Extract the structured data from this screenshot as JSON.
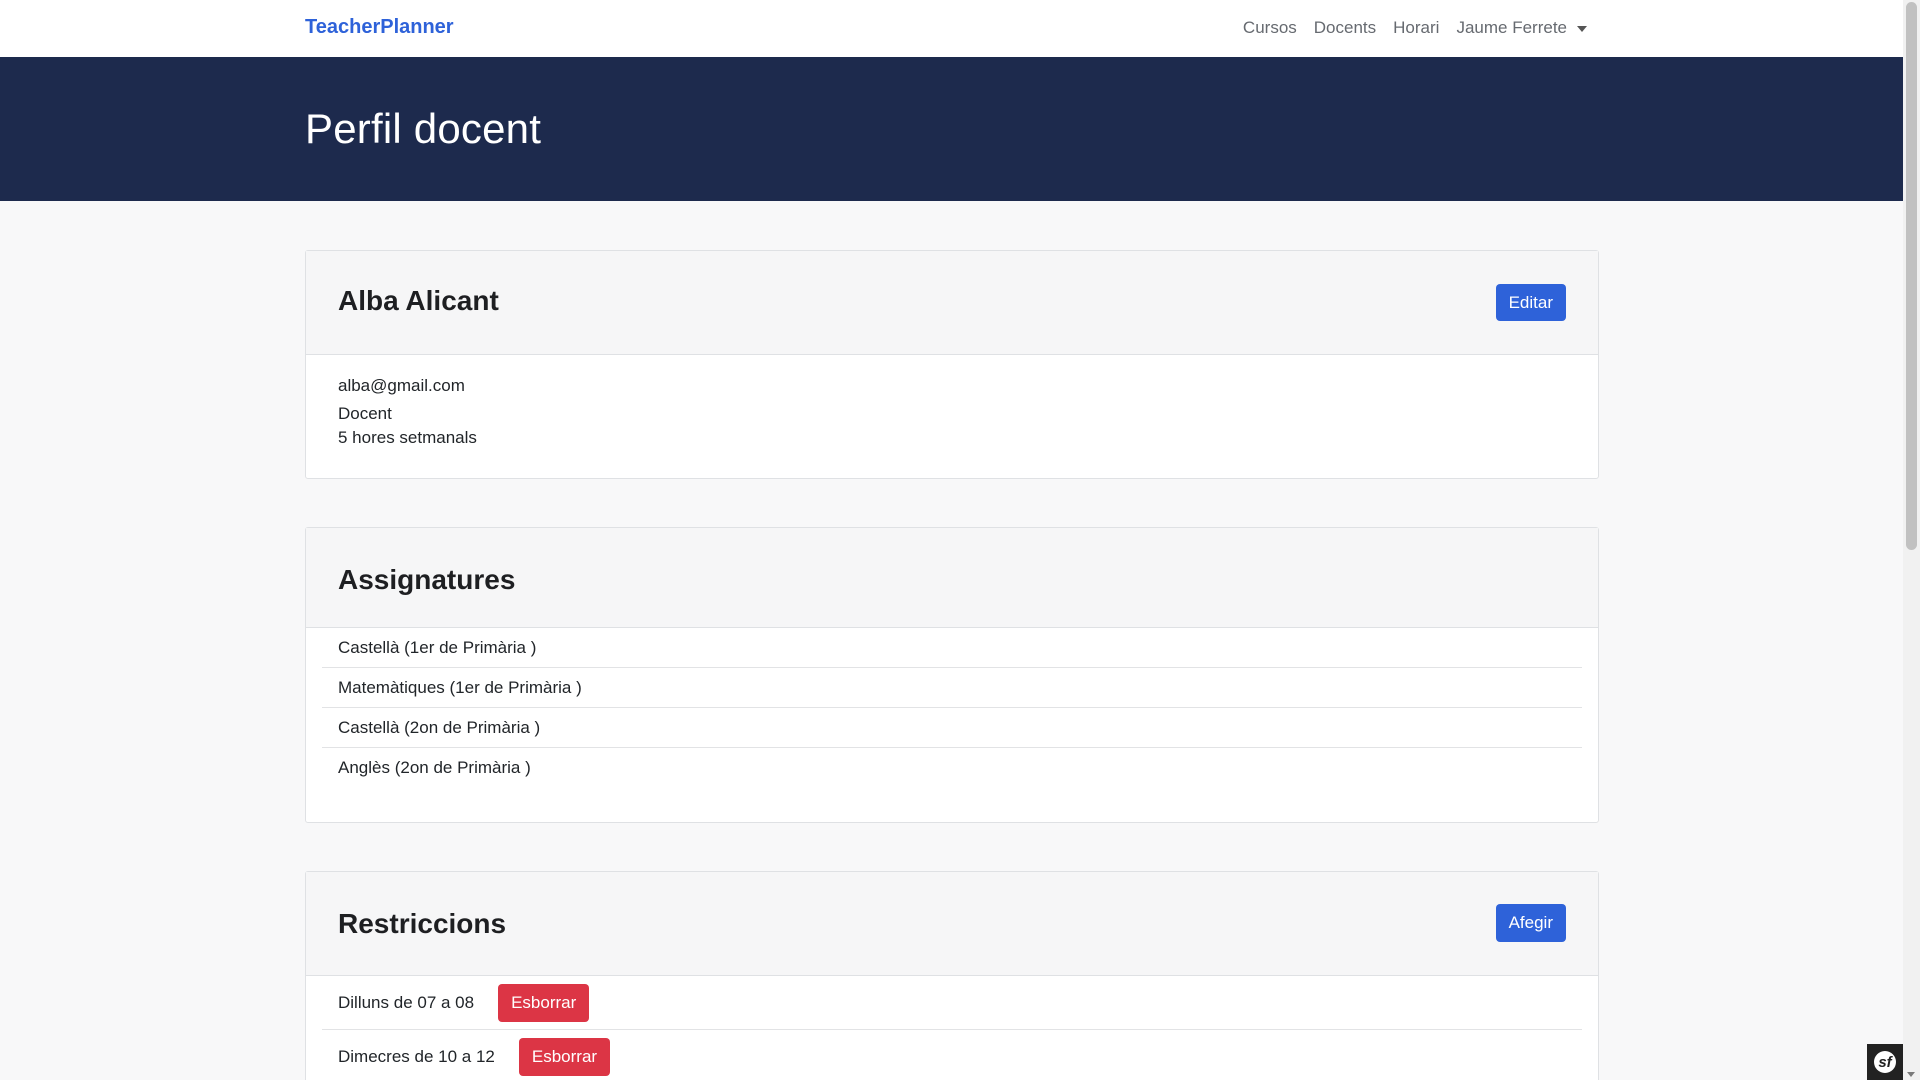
{
  "navbar": {
    "brand": "TeacherPlanner",
    "links": [
      "Cursos",
      "Docents",
      "Horari"
    ],
    "user": "Jaume Ferrete"
  },
  "hero": {
    "title": "Perfil docent"
  },
  "profile": {
    "name": "Alba Alicant",
    "edit_label": "Editar",
    "email": "alba@gmail.com",
    "role": "Docent",
    "hours": "5 hores setmanals"
  },
  "subjects": {
    "title": "Assignatures",
    "items": [
      "Castellà (1er de Primària )",
      "Matemàtiques (1er de Primària )",
      "Castellà (2on de Primària )",
      "Anglès (2on de Primària )"
    ]
  },
  "restrictions": {
    "title": "Restriccions",
    "add_label": "Afegir",
    "items": [
      {
        "text": "Dilluns de 07 a 08",
        "delete_label": "Esborrar"
      },
      {
        "text": "Dimecres de 10 a 12",
        "delete_label": "Esborrar"
      }
    ]
  },
  "colors": {
    "brand": "#2e62d9",
    "hero_bg": "#1d2a4d",
    "primary": "#2e62d9",
    "danger": "#dc3545"
  },
  "debug_toolbar": {
    "icon": "symfony-icon",
    "label": "sf"
  }
}
